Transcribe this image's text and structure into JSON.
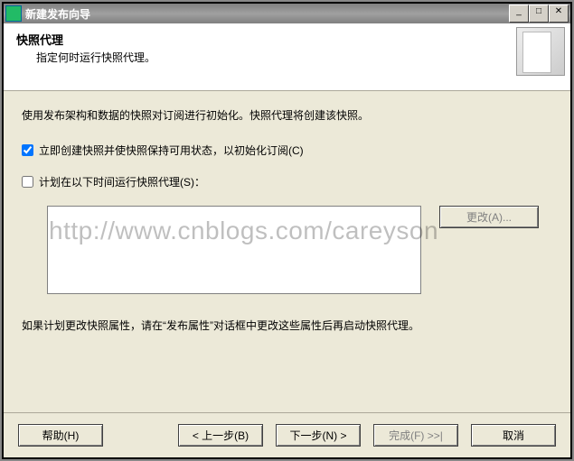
{
  "window": {
    "title": "新建发布向导",
    "minimize_aria": "Minimize",
    "restore_aria": "Restore",
    "close_aria": "Close"
  },
  "header": {
    "title": "快照代理",
    "subtitle": "指定何时运行快照代理。"
  },
  "body": {
    "intro": "使用发布架构和数据的快照对订阅进行初始化。快照代理将创建该快照。",
    "checkbox_create_now": "立即创建快照并使快照保持可用状态，以初始化订阅(C)",
    "checkbox_schedule": "计划在以下时间运行快照代理(S)：",
    "change_button": "更改(A)...",
    "footer_note": "如果计划更改快照属性，请在“发布属性”对话框中更改这些属性后再启动快照代理。"
  },
  "buttons": {
    "help": "帮助(H)",
    "back": "< 上一步(B)",
    "next": "下一步(N) >",
    "finish": "完成(F) >>|",
    "cancel": "取消"
  },
  "state": {
    "create_now_checked": true,
    "schedule_checked": false
  },
  "watermark": "http://www.cnblogs.com/careyson"
}
